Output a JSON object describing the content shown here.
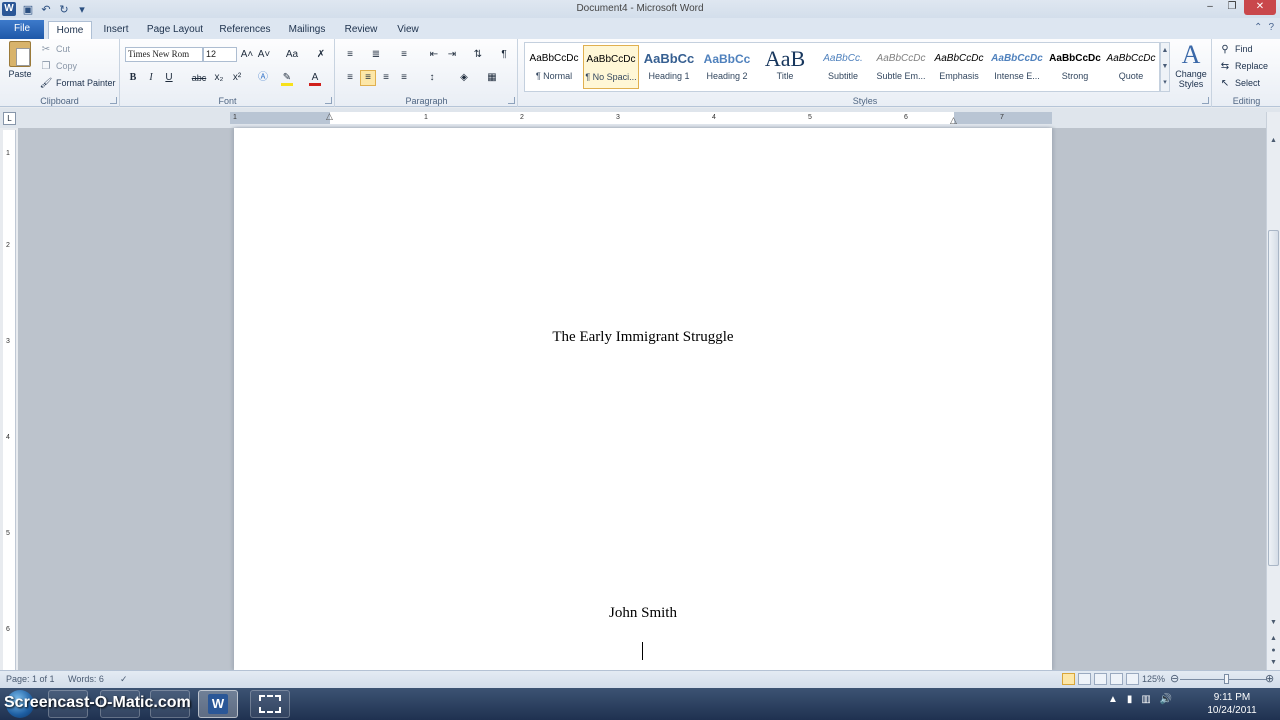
{
  "window": {
    "title": "Document4  -  Microsoft Word",
    "app_icon": "W",
    "minimize_glyph": "–",
    "restore_glyph": "❐",
    "close_glyph": "✕"
  },
  "quick_access": {
    "save_icon": "floppy-disk-icon",
    "undo_icon": "undo-icon",
    "redo_icon": "redo-icon",
    "customize_icon": "dropdown-icon"
  },
  "tabs": [
    {
      "label": "File"
    },
    {
      "label": "Home"
    },
    {
      "label": "Insert"
    },
    {
      "label": "Page Layout"
    },
    {
      "label": "References"
    },
    {
      "label": "Mailings"
    },
    {
      "label": "Review"
    },
    {
      "label": "View"
    }
  ],
  "ribbon": {
    "clipboard": {
      "label": "Clipboard",
      "paste": "Paste",
      "cut": "Cut",
      "copy": "Copy",
      "format_painter": "Format Painter"
    },
    "font": {
      "label": "Font",
      "font_name": "Times New Rom",
      "font_size": "12",
      "bold": "B",
      "italic": "I",
      "underline": "U",
      "strike": "abc",
      "subscript": "x₂",
      "superscript": "x²",
      "grow": "A˄",
      "shrink": "A˅",
      "change_case": "Aa",
      "font_color": "A",
      "highlight_color": "#f7e11c",
      "font_color_value": "#d0201c"
    },
    "paragraph": {
      "label": "Paragraph",
      "pilcrow": "¶"
    },
    "styles": {
      "label": "Styles",
      "items": [
        {
          "sample": "AaBbCcDc",
          "name": "¶ Normal"
        },
        {
          "sample": "AaBbCcDc",
          "name": "¶ No Spaci..."
        },
        {
          "sample": "AaBbCc",
          "name": "Heading 1"
        },
        {
          "sample": "AaBbCc",
          "name": "Heading 2"
        },
        {
          "sample": "AaB",
          "name": "Title"
        },
        {
          "sample": "AaBbCc.",
          "name": "Subtitle"
        },
        {
          "sample": "AaBbCcDc",
          "name": "Subtle Em..."
        },
        {
          "sample": "AaBbCcDc",
          "name": "Emphasis"
        },
        {
          "sample": "AaBbCcDc",
          "name": "Intense E..."
        },
        {
          "sample": "AaBbCcDc",
          "name": "Strong"
        },
        {
          "sample": "AaBbCcDc",
          "name": "Quote"
        }
      ],
      "change_styles_line1": "Change",
      "change_styles_line2": "Styles",
      "change_styles_glyph": "A"
    },
    "editing": {
      "label": "Editing",
      "find": "Find",
      "replace": "Replace",
      "select": "Select"
    }
  },
  "ruler": {
    "tab_selector": "L",
    "h_numbers": [
      "1",
      "1",
      "2",
      "3",
      "4",
      "5",
      "6",
      "7"
    ],
    "v_numbers": [
      "1",
      "2",
      "3",
      "4",
      "5",
      "6"
    ]
  },
  "document": {
    "title": "The Early Immigrant Struggle",
    "author": "John Smith"
  },
  "scrollbar": {
    "up_arrow": "▲",
    "down_arrow": "▼"
  },
  "statusbar": {
    "page": "Page: 1 of 1",
    "words": "Words: 6",
    "zoom": "125%",
    "zoom_out": "⊖",
    "zoom_in": "⊕"
  },
  "taskbar": {
    "brand": "Screencast-O-Matic.com",
    "time": "9:11 PM",
    "date": "10/24/2011",
    "tray_up": "▲"
  }
}
